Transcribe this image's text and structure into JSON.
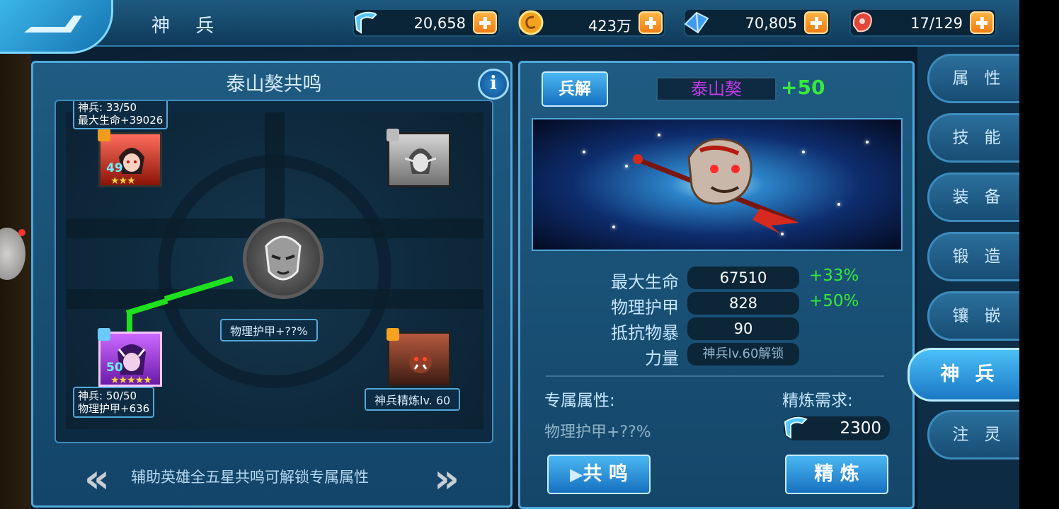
{
  "header": {
    "title": "神 兵",
    "resources": [
      {
        "icon": "blue-crystal-icon",
        "value": "20,658"
      },
      {
        "icon": "gold-coin-icon",
        "value": "423万"
      },
      {
        "icon": "diamond-icon",
        "value": "70,805"
      },
      {
        "icon": "meat-stamina-icon",
        "value": "17/129"
      }
    ]
  },
  "resonance": {
    "title": "泰山獒共鸣",
    "info_label": "i",
    "top_left_tag": {
      "line1": "神兵: 33/50",
      "line2": "最大生命+39026"
    },
    "bottom_left_tag": {
      "line1": "神兵: 50/50",
      "line2": "物理护甲+636"
    },
    "center_label": "物理护甲+??%",
    "bottom_right_label": "神兵精炼lv. 60",
    "heroes": [
      {
        "name": "red-hair-hero",
        "level": "49",
        "stars": "★★★"
      },
      {
        "name": "elf-hero-locked",
        "level": "",
        "stars": ""
      },
      {
        "name": "purple-demon-hero",
        "level": "50",
        "stars": "★★★★★"
      },
      {
        "name": "orc-hero-locked",
        "level": "",
        "stars": ""
      }
    ],
    "hint": "辅助英雄全五星共鸣可解锁专属属性",
    "prev_arrow": "«",
    "next_arrow": "»"
  },
  "weapon": {
    "disassemble_label": "兵解",
    "name": "泰山獒",
    "plus_level": "+50",
    "stats": [
      {
        "label": "最大生命",
        "value": "67510",
        "bonus": "+33%"
      },
      {
        "label": "物理护甲",
        "value": "828",
        "bonus": "+50%"
      },
      {
        "label": "抵抗物暴",
        "value": "90",
        "bonus": ""
      },
      {
        "label": "力量",
        "value": "神兵lv.60解锁",
        "bonus": ""
      }
    ],
    "exclusive_heading": "专属属性:",
    "refine_heading": "精炼需求:",
    "exclusive_value": "物理护甲+??%",
    "refine_cost": "2300",
    "resonate_label": "共 鸣",
    "refine_label": "精 炼"
  },
  "tabs": [
    {
      "label": "属性"
    },
    {
      "label": "技能"
    },
    {
      "label": "装备"
    },
    {
      "label": "锻造"
    },
    {
      "label": "镶嵌"
    },
    {
      "label": "神兵",
      "active": true
    },
    {
      "label": "注灵"
    }
  ]
}
